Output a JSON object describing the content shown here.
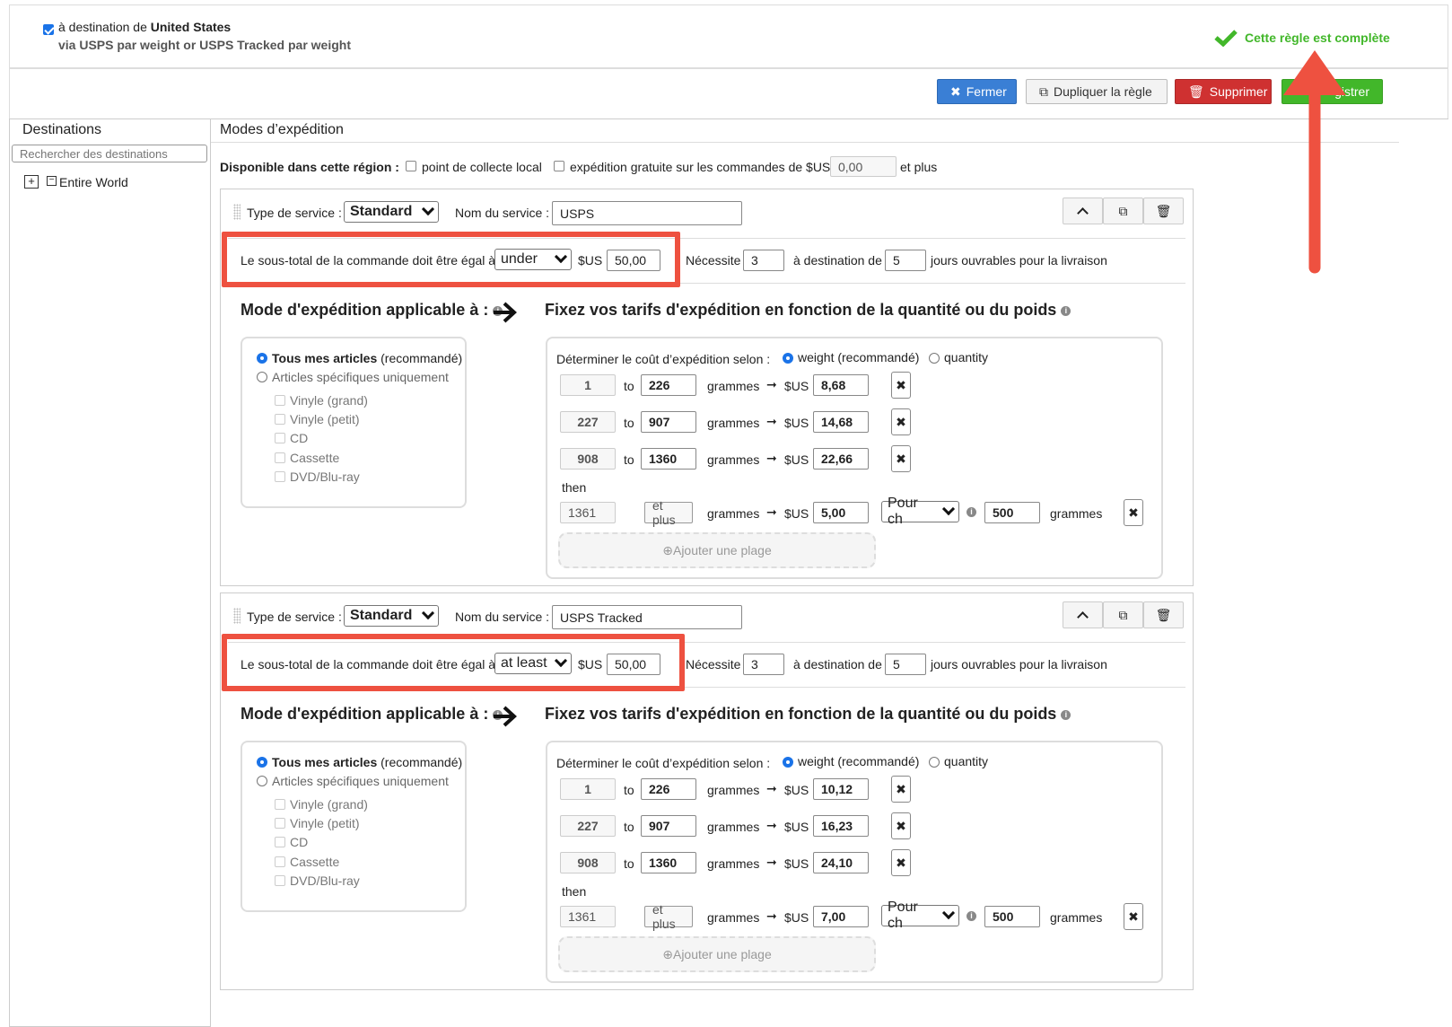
{
  "header": {
    "destination_prefix": "à destination de",
    "destination_country": "United States",
    "via_text": "via USPS par weight or USPS Tracked par weight",
    "status_text": "Cette règle est complète",
    "status_color": "#42b72a"
  },
  "toolbar": {
    "close_label": "Fermer",
    "duplicate_label": "Dupliquer la règle",
    "delete_label": "Supprimer",
    "save_label": "gistrer"
  },
  "left": {
    "title": "Destinations",
    "search_placeholder": "Rechercher des destinations",
    "tree_item": "Entire World"
  },
  "right": {
    "title": "Modes d’expédition",
    "region_label": "Disponible dans cette région :",
    "local_pickup_label": "point de collecte local",
    "free_shipping_label": "expédition gratuite sur les commandes de $US",
    "free_shipping_value": "0,00",
    "and_more": "et plus"
  },
  "services": [
    {
      "type_label": "Type de service :",
      "type_value": "Standard",
      "name_label": "Nom du service :",
      "name_value": "USPS",
      "subtotal_label": "Le sous-total de la commande doit être égal à",
      "subtotal_op": "under",
      "currency": "$US",
      "subtotal_value": "50,00",
      "requires_label": "Nécessite",
      "requires_min": "3",
      "to_label": "à destination de",
      "requires_max": "5",
      "days_label": "jours ouvrables pour la livraison",
      "applicable_title": "Mode d'expédition applicable à :",
      "rates_title": "Fixez vos tarifs d'expédition en fonction de la quantité ou du poids",
      "all_items_bold": "Tous mes articles",
      "all_items_rec": "(recommandé)",
      "specific_items": "Articles spécifiques uniquement",
      "items": [
        "Vinyle (grand)",
        "Vinyle (petit)",
        "CD",
        "Cassette",
        "DVD/Blu-ray"
      ],
      "determine_label": "Déterminer le coût d’expédition selon :",
      "weight_option": "weight (recommandé)",
      "quantity_option": "quantity",
      "ranges": [
        {
          "from": "1",
          "to": "226",
          "price": "8,68"
        },
        {
          "from": "227",
          "to": "907",
          "price": "14,68"
        },
        {
          "from": "908",
          "to": "1360",
          "price": "22,66"
        }
      ],
      "to_word": "to",
      "unit": "grammes",
      "then_label": "then",
      "then_from": "1361",
      "then_etplus": "et plus",
      "then_price": "5,00",
      "per_select": "Pour ch",
      "per_value": "500",
      "add_range": "Ajouter une plage"
    },
    {
      "type_label": "Type de service :",
      "type_value": "Standard",
      "name_label": "Nom du service :",
      "name_value": "USPS Tracked",
      "subtotal_label": "Le sous-total de la commande doit être égal à",
      "subtotal_op": "at least",
      "currency": "$US",
      "subtotal_value": "50,00",
      "requires_label": "Nécessite",
      "requires_min": "3",
      "to_label": "à destination de",
      "requires_max": "5",
      "days_label": "jours ouvrables pour la livraison",
      "applicable_title": "Mode d'expédition applicable à :",
      "rates_title": "Fixez vos tarifs d'expédition en fonction de la quantité ou du poids",
      "all_items_bold": "Tous mes articles",
      "all_items_rec": "(recommandé)",
      "specific_items": "Articles spécifiques uniquement",
      "items": [
        "Vinyle (grand)",
        "Vinyle (petit)",
        "CD",
        "Cassette",
        "DVD/Blu-ray"
      ],
      "determine_label": "Déterminer le coût d’expédition selon :",
      "weight_option": "weight (recommandé)",
      "quantity_option": "quantity",
      "ranges": [
        {
          "from": "1",
          "to": "226",
          "price": "10,12"
        },
        {
          "from": "227",
          "to": "907",
          "price": "16,23"
        },
        {
          "from": "908",
          "to": "1360",
          "price": "24,10"
        }
      ],
      "to_word": "to",
      "unit": "grammes",
      "then_label": "then",
      "then_from": "1361",
      "then_etplus": "et plus",
      "then_price": "7,00",
      "per_select": "Pour ch",
      "per_value": "500",
      "add_range": "Ajouter une plage"
    }
  ],
  "annotation": {
    "highlight_color": "#ee5140",
    "arrow_color": "#ee5140"
  }
}
